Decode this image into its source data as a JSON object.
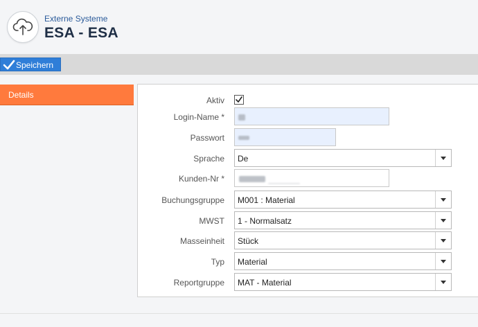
{
  "header": {
    "subtitle": "Externe Systeme",
    "title": "ESA - ESA",
    "logo_icon": "cloud-upload-icon"
  },
  "toolbar": {
    "save_label": "Speichern",
    "save_icon": "checkmark-icon"
  },
  "sidebar": {
    "active_tab": "Details"
  },
  "form": {
    "aktiv": {
      "label": "Aktiv",
      "checked": true
    },
    "login_name": {
      "label": "Login-Name *",
      "value": ""
    },
    "passwort": {
      "label": "Passwort",
      "value": ""
    },
    "sprache": {
      "label": "Sprache",
      "value": "De"
    },
    "kunden_nr": {
      "label": "Kunden-Nr *",
      "value": ""
    },
    "buchungsgruppe": {
      "label": "Buchungsgruppe",
      "value": "M001 : Material"
    },
    "mwst": {
      "label": "MWST",
      "value": "1 - Normalsatz"
    },
    "masseinheit": {
      "label": "Masseinheit",
      "value": "Stück"
    },
    "typ": {
      "label": "Typ",
      "value": "Material"
    },
    "reportgruppe": {
      "label": "Reportgruppe",
      "value": "MAT - Material"
    }
  },
  "colors": {
    "accent_orange": "#ff7a3d",
    "save_blue": "#2f7ed8",
    "title_navy": "#1f2f46",
    "subtitle_blue": "#2a5a9a",
    "autofill_blue": "#e8f0fe"
  }
}
